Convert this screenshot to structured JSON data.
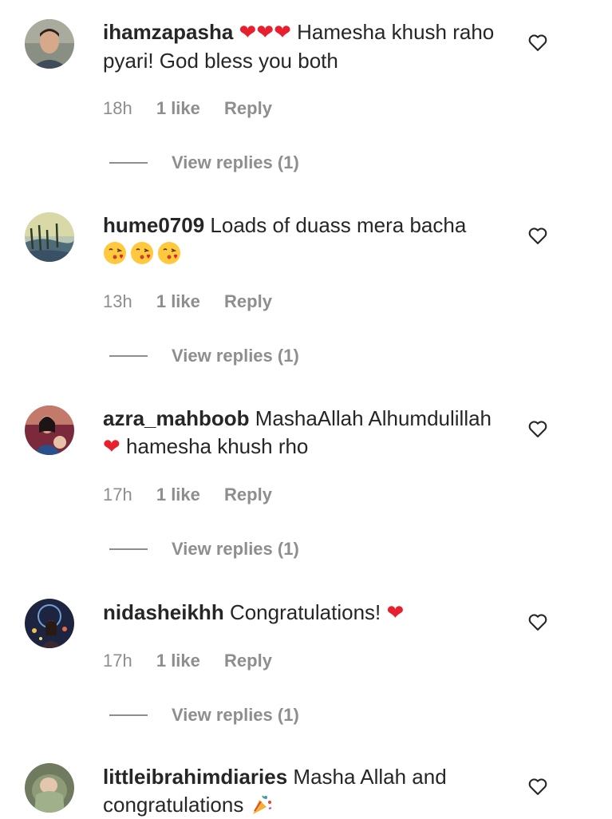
{
  "comments": [
    {
      "username": "ihamzapasha",
      "emoji_prefix": "❤❤❤",
      "text": "Hamesha khush raho pyari! God bless you both",
      "time": "18h",
      "likes": "1 like",
      "reply": "Reply",
      "view_replies": "View replies (1)"
    },
    {
      "username": "hume0709",
      "text": "Loads of duass mera bacha",
      "emoji_suffix": "😘😘😘",
      "time": "13h",
      "likes": "1 like",
      "reply": "Reply",
      "view_replies": "View replies (1)"
    },
    {
      "username": "azra_mahboob",
      "text_a": "MashaAllah Alhumdulillah",
      "emoji_mid": "❤",
      "text_b": "hamesha khush rho",
      "time": "17h",
      "likes": "1 like",
      "reply": "Reply",
      "view_replies": "View replies (1)"
    },
    {
      "username": "nidasheikhh",
      "text": "Congratulations!",
      "emoji_suffix": "❤",
      "time": "17h",
      "likes": "1 like",
      "reply": "Reply",
      "view_replies": "View replies (1)"
    },
    {
      "username": "littleibrahimdiaries",
      "text": "Masha Allah and congratulations",
      "emoji_suffix": "🎉"
    }
  ],
  "icons": {
    "like": "heart-outline-icon",
    "avatar": "avatar-image"
  },
  "colors": {
    "text": "#262626",
    "secondary": "#8e8e8e",
    "heart": "#e8202e"
  }
}
